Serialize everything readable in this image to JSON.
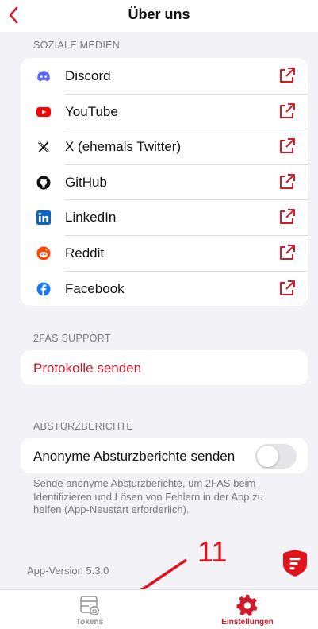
{
  "header": {
    "title": "Über uns"
  },
  "social": {
    "section_title": "SOZIALE MEDIEN",
    "items": [
      {
        "label": "Discord",
        "icon": "discord-icon",
        "color": "#5865f2"
      },
      {
        "label": "YouTube",
        "icon": "youtube-icon",
        "color": "#ff0000"
      },
      {
        "label": "X (ehemals Twitter)",
        "icon": "x-twitter-icon",
        "color": "#000000"
      },
      {
        "label": "GitHub",
        "icon": "github-icon",
        "color": "#111111"
      },
      {
        "label": "LinkedIn",
        "icon": "linkedin-icon",
        "color": "#0a66c2"
      },
      {
        "label": "Reddit",
        "icon": "reddit-icon",
        "color": "#ff4500"
      },
      {
        "label": "Facebook",
        "icon": "facebook-icon",
        "color": "#1877f2"
      }
    ]
  },
  "support": {
    "section_title": "2FAS SUPPORT",
    "link_label": "Protokolle senden"
  },
  "crash_reports": {
    "section_title": "ABSTURZBERICHTE",
    "toggle_label": "Anonyme Absturzberichte senden",
    "toggle_on": false,
    "footnote": "Sende anonyme Absturzberichte, um 2FAS beim Identifizieren und Lösen von Fehlern in der App zu helfen (App-Neustart erforderlich)."
  },
  "footer": {
    "version": "App-Version 5.3.0"
  },
  "annotation": {
    "number": "11",
    "color": "#e0121c"
  },
  "tabbar": {
    "tokens_label": "Tokens",
    "settings_label": "Einstellungen",
    "active_color": "#d11b2b",
    "inactive_color": "#8e8e93"
  },
  "colors": {
    "accent": "#d11b2b",
    "background": "#f2f2f7"
  }
}
